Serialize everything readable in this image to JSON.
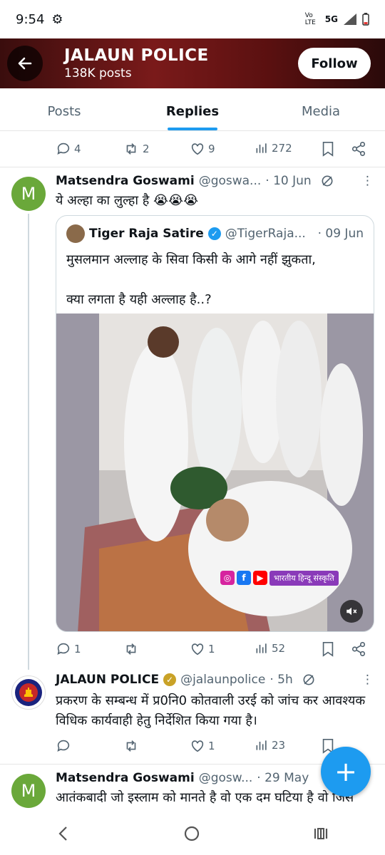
{
  "status_bar": {
    "time": "9:54",
    "network": "5G",
    "volte": "Vo LTE"
  },
  "header": {
    "name": "JALAUN POLICE",
    "post_count": "138K posts",
    "follow_label": "Follow"
  },
  "tabs": [
    {
      "label": "Posts"
    },
    {
      "label": "Replies"
    },
    {
      "label": "Media"
    }
  ],
  "top_actions": {
    "replies": "4",
    "reposts": "2",
    "likes": "9",
    "views": "272"
  },
  "tweet1": {
    "avatar_letter": "M",
    "name": "Matsendra Goswami",
    "handle": "@goswa...",
    "date": "· 10 Jun",
    "text": "ये अल्हा का लुल्हा है 😭😭😭",
    "quote": {
      "name": "Tiger Raja Satire",
      "handle": "@TigerRaja...",
      "date": "· 09 Jun",
      "text": "मुसलमान अल्लाह के सिवा किसी के आगे नहीं झुकता,\n\nक्या लगता है यही अल्लाह है..?",
      "watermark": "भारतीय हिन्दू संस्कृति"
    },
    "actions": {
      "replies": "1",
      "reposts": "",
      "likes": "1",
      "views": "52"
    }
  },
  "tweet2": {
    "name": "JALAUN POLICE",
    "handle": "@jalaunpolice",
    "date": "· 5h",
    "text": "प्रकरण के सम्बन्ध में प्र0नि0 कोतवाली उरई को जांच कर आवश्यक विधिक कार्यवाही हेतु निर्देशित किया गया है।",
    "actions": {
      "replies": "",
      "reposts": "",
      "likes": "1",
      "views": "23"
    }
  },
  "tweet3": {
    "avatar_letter": "M",
    "name": "Matsendra Goswami",
    "handle": "@gosw...",
    "date": "· 29 May",
    "text": "आतंकबादी जो इस्लाम को मानते है वो एक दम घटिया है वो जिस"
  },
  "fab_label": "+",
  "colors": {
    "accent": "#1d9bf0",
    "avatar_green": "#6aa83a"
  }
}
